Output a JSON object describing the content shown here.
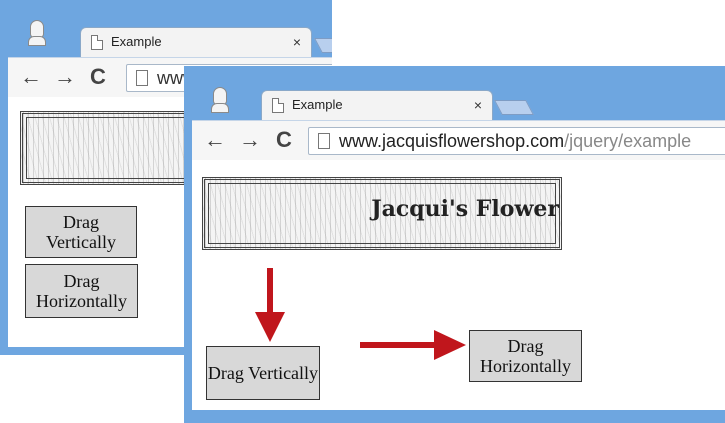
{
  "back_window": {
    "tab_title": "Example",
    "tab_close": "×",
    "url_visible": "www",
    "drag_vertical_label": "Drag Vertically",
    "drag_horizontal_label": "Drag Horizontally"
  },
  "front_window": {
    "tab_title": "Example",
    "tab_close": "×",
    "url_host": "www.jacquisflowershop.com",
    "url_path": "/jquery/example",
    "banner_title": "Jacqui's Flower",
    "drag_vertical_label": "Drag Vertically",
    "drag_horizontal_label": "Drag Horizontally"
  },
  "nav": {
    "back": "←",
    "forward": "→",
    "reload": "C"
  },
  "colors": {
    "window_frame": "#6ea6e0",
    "arrow": "#c0161c",
    "drag_box": "#d8d8d8"
  }
}
